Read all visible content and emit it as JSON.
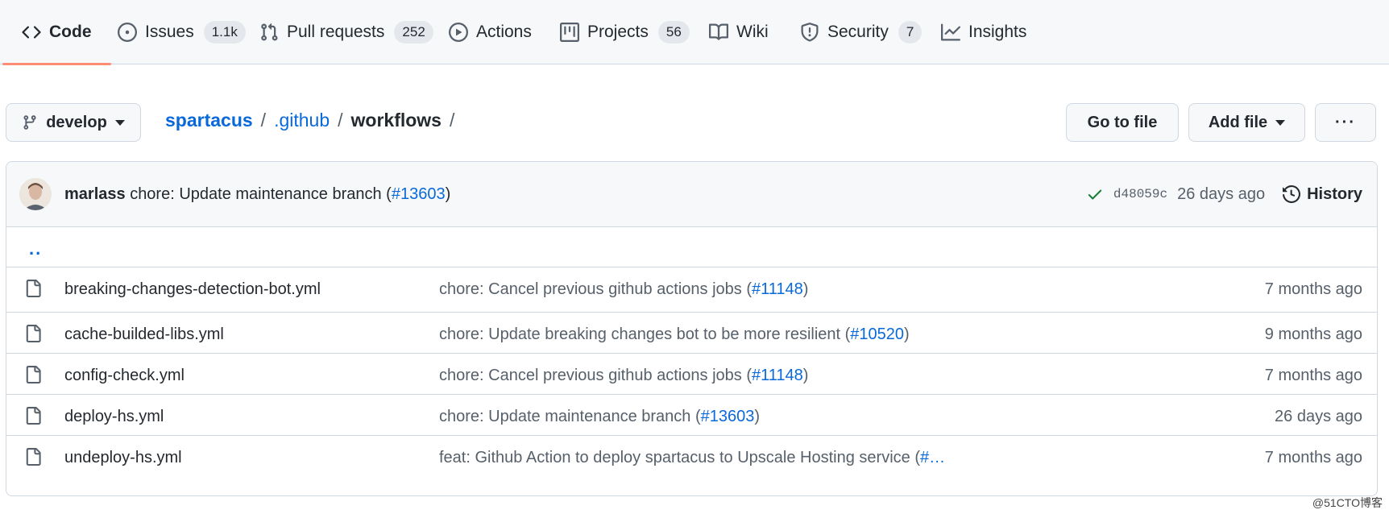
{
  "tabs": [
    {
      "label": "Code",
      "icon": "code-icon",
      "counter": ""
    },
    {
      "label": "Issues",
      "icon": "issue-opened-icon",
      "counter": "1.1k"
    },
    {
      "label": "Pull requests",
      "icon": "git-pull-request-icon",
      "counter": "252"
    },
    {
      "label": "Actions",
      "icon": "play-icon",
      "counter": ""
    },
    {
      "label": "Projects",
      "icon": "table-icon",
      "counter": "56"
    },
    {
      "label": "Wiki",
      "icon": "book-icon",
      "counter": ""
    },
    {
      "label": "Security",
      "icon": "shield-icon",
      "counter": "7"
    },
    {
      "label": "Insights",
      "icon": "graph-icon",
      "counter": ""
    }
  ],
  "branch": {
    "name": "develop",
    "icon": "git-branch-icon"
  },
  "breadcrumb": {
    "repo": "spartacus",
    "folder": ".github",
    "current": "workflows",
    "separator": "/"
  },
  "actions": {
    "go_to_file": "Go to file",
    "add_file": "Add file",
    "more": "···"
  },
  "latest_commit": {
    "author": "marlass",
    "message": "chore: Update maintenance branch (",
    "pr": "#13603",
    "suffix": ")",
    "sha": "d48059c",
    "age": "26 days ago",
    "history_label": "History",
    "status": "success"
  },
  "updir": "..",
  "files": [
    {
      "name": "breaking-changes-detection-bot.yml",
      "msg": "chore: Cancel previous github actions jobs (",
      "pr": "#11148",
      "msg_end": ")",
      "age": "7 months ago"
    },
    {
      "name": "cache-builded-libs.yml",
      "msg": "chore: Update breaking changes bot to be more resilient (",
      "pr": "#10520",
      "msg_end": ")",
      "age": "9 months ago"
    },
    {
      "name": "config-check.yml",
      "msg": "chore: Cancel previous github actions jobs (",
      "pr": "#11148",
      "msg_end": ")",
      "age": "7 months ago"
    },
    {
      "name": "deploy-hs.yml",
      "msg": "chore: Update maintenance branch (",
      "pr": "#13603",
      "msg_end": ")",
      "age": "26 days ago"
    },
    {
      "name": "undeploy-hs.yml",
      "msg": "feat: Github Action to deploy spartacus to Upscale Hosting service (",
      "pr": "#…",
      "msg_end": "",
      "age": "7 months ago"
    }
  ],
  "watermark": "@51CTO博客",
  "colors": {
    "accent_link": "#0969da",
    "active_tab_underline": "#fd8c73",
    "success": "#1a7f37"
  }
}
